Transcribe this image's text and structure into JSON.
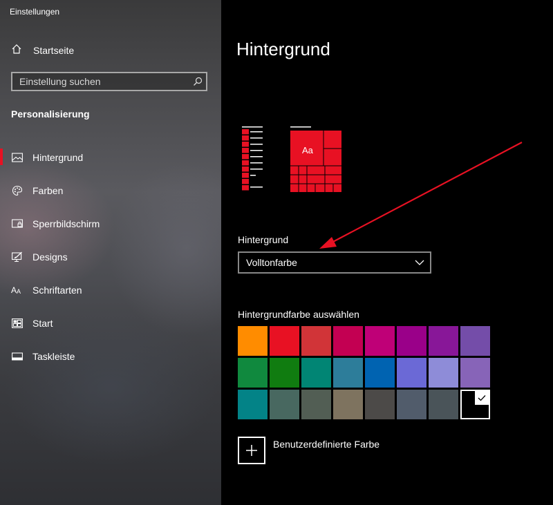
{
  "window": {
    "title": "Einstellungen"
  },
  "sidebar": {
    "home_label": "Startseite",
    "search_placeholder": "Einstellung suchen",
    "section_title": "Personalisierung",
    "items": [
      {
        "label": "Hintergrund",
        "icon": "picture-icon",
        "active": true
      },
      {
        "label": "Farben",
        "icon": "palette-icon"
      },
      {
        "label": "Sperrbildschirm",
        "icon": "lock-screen-icon"
      },
      {
        "label": "Designs",
        "icon": "designs-icon"
      },
      {
        "label": "Schriftarten",
        "icon": "font-icon"
      },
      {
        "label": "Start",
        "icon": "start-icon"
      },
      {
        "label": "Taskleiste",
        "icon": "taskbar-icon"
      }
    ]
  },
  "main": {
    "title": "Hintergrund",
    "preview": {
      "tile_text": "Aa",
      "accent": "#e81123"
    },
    "background_label": "Hintergrund",
    "background_value": "Volltonfarbe",
    "color_label": "Hintergrundfarbe auswählen",
    "swatches": [
      [
        "#ff8c00",
        "#e81123",
        "#d13438",
        "#c30052",
        "#bf0077",
        "#9a0089",
        "#881798",
        "#744da9"
      ],
      [
        "#10893e",
        "#107c10",
        "#018574",
        "#2d7d9a",
        "#0063b1",
        "#6b69d6",
        "#8e8cd8",
        "#8764b8"
      ],
      [
        "#038387",
        "#486860",
        "#525e54",
        "#7e735f",
        "#4c4a48",
        "#515c6b",
        "#4a5459",
        "#000000"
      ]
    ],
    "selected_swatch": [
      2,
      7
    ],
    "custom_color_label": "Benutzerdefinierte Farbe"
  },
  "annotation": {
    "arrow_color": "#e81123"
  }
}
